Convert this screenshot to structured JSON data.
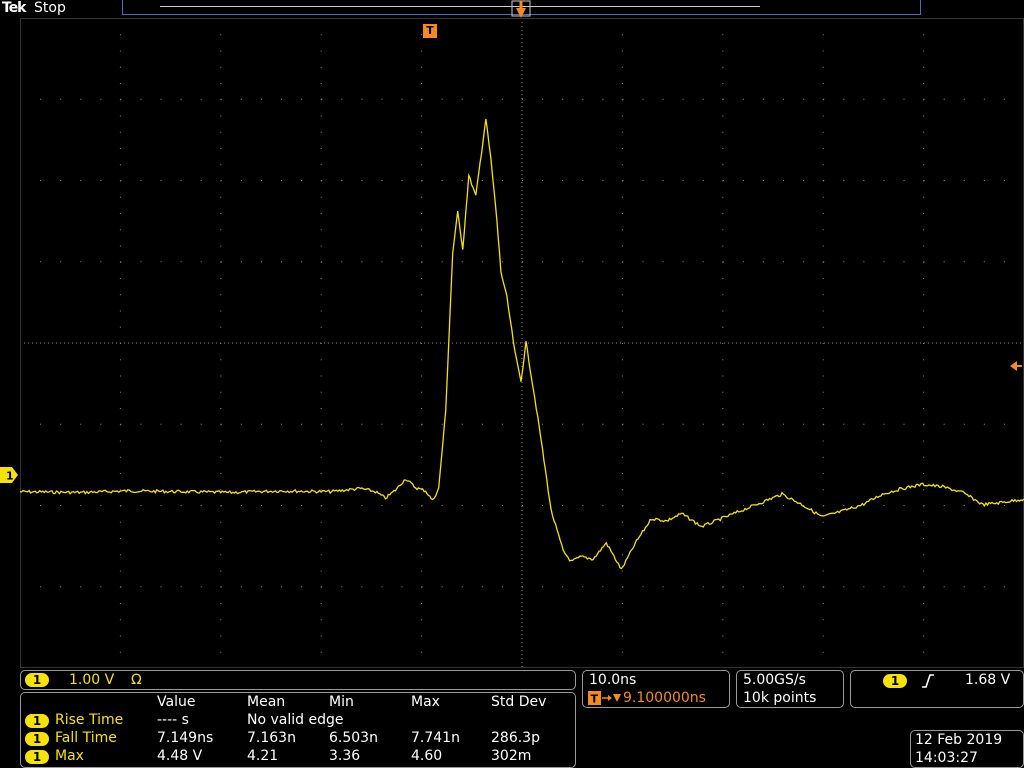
{
  "header": {
    "brand": "Tek",
    "run_state": "Stop"
  },
  "trigger_marker": "T",
  "channel_panel": {
    "channel": "1",
    "scale": "1.00 V",
    "coupling": "Ω"
  },
  "measurements": {
    "headers": [
      "Value",
      "Mean",
      "Min",
      "Max",
      "Std Dev"
    ],
    "rows": [
      {
        "channel": "1",
        "name": "Rise Time",
        "value": "---- s",
        "note": "No valid edge"
      },
      {
        "channel": "1",
        "name": "Fall Time",
        "value": "7.149ns",
        "mean": "7.163n",
        "min": "6.503n",
        "max": "7.741n",
        "std": "286.3p"
      },
      {
        "channel": "1",
        "name": "Max",
        "value": "4.48 V",
        "mean": "4.21",
        "min": "3.36",
        "max": "4.60",
        "std": "302m"
      }
    ]
  },
  "timebase": {
    "scale": "10.0ns",
    "trigger_position": "9.100000ns"
  },
  "acquisition": {
    "sample_rate": "5.00GS/s",
    "record_length": "10k points"
  },
  "trigger": {
    "channel": "1",
    "slope_icon": "rising-edge-icon",
    "level": "1.68 V"
  },
  "datetime": {
    "date": "12 Feb  2019",
    "time": "14:03:27"
  },
  "colors": {
    "channel1": "#f5e20a",
    "trigger": "#f58a1f",
    "grid": "#8a8a8a",
    "background": "#000000"
  },
  "chart_data": {
    "type": "line",
    "title": "",
    "xlabel": "",
    "ylabel": "",
    "grid": true,
    "xlim": [
      -45.9,
      54.1
    ],
    "ylim": [
      -2.16,
      5.84
    ],
    "x_unit": "ns",
    "y_unit": "V",
    "series": [
      {
        "x": [
          -45.9,
          -40,
          -35,
          -30,
          -25,
          -20,
          -15,
          -12,
          -10.5,
          -9.5,
          -8.5,
          -7.5,
          -6.5,
          -5.5,
          -4.8,
          -4.2,
          -3.5,
          -2.8,
          -2.3,
          -1.8,
          -1.2,
          -0.5,
          0.5,
          1.0,
          1.6,
          2.0,
          2.6,
          3.4,
          4.0,
          4.5,
          5.2,
          6.0,
          7.0,
          8.2,
          9.0,
          10.0,
          11.2,
          12.5,
          14.0,
          15.5,
          17.0,
          18.5,
          20.0,
          22.0,
          24.0,
          26.0,
          28.0,
          30.0,
          32.0,
          34.0,
          36.0,
          38.0,
          40.0,
          42.0,
          44.0,
          46.0,
          48.0,
          50.0,
          52.0,
          54.1
        ],
        "y": [
          0.01,
          0.0,
          0.02,
          0.01,
          0.0,
          0.02,
          0.01,
          0.05,
          0.01,
          -0.07,
          0.03,
          0.17,
          0.06,
          0.02,
          -0.1,
          0.05,
          1.0,
          2.95,
          3.45,
          3.0,
          3.9,
          3.65,
          4.6,
          4.1,
          3.35,
          2.72,
          2.4,
          1.72,
          1.37,
          1.85,
          1.3,
          0.65,
          -0.22,
          -0.72,
          -0.85,
          -0.79,
          -0.82,
          -0.62,
          -0.95,
          -0.6,
          -0.32,
          -0.35,
          -0.26,
          -0.42,
          -0.32,
          -0.22,
          -0.12,
          -0.02,
          -0.15,
          -0.3,
          -0.23,
          -0.15,
          -0.02,
          0.05,
          0.1,
          0.07,
          0.0,
          -0.15,
          -0.12,
          -0.08
        ]
      }
    ]
  }
}
